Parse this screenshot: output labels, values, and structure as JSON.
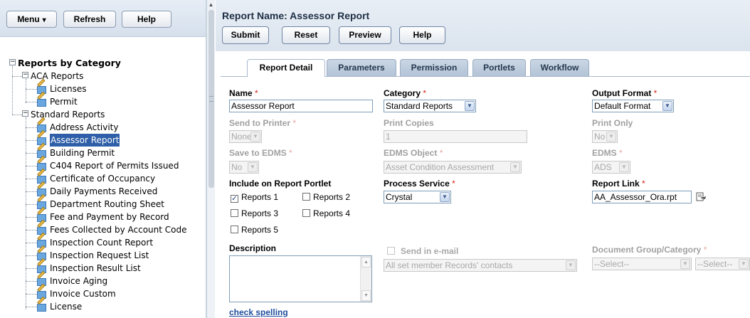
{
  "left_toolbar": {
    "menu_label": "Menu",
    "menu_caret": "▾",
    "refresh_label": "Refresh",
    "help_label": "Help"
  },
  "tree": {
    "root_label": "Reports by Category",
    "groups": [
      {
        "label": "ACA Reports",
        "items": [
          "Licenses",
          "Permit"
        ]
      },
      {
        "label": "Standard Reports",
        "items": [
          "Address Activity",
          "Assessor Report",
          "Building Permit",
          "C404 Report of Permits Issued",
          "Certificate of Occupancy",
          "Daily Payments Received",
          "Department Routing Sheet",
          "Fee and Payment by Record",
          "Fees Collected by Account Code",
          "Inspection Count Report",
          "Inspection Request List",
          "Inspection Result List",
          "Invoice Aging",
          "Invoice Custom",
          "License"
        ]
      }
    ],
    "selected_item": "Assessor Report"
  },
  "header": {
    "title": "Report Name: Assessor Report",
    "submit_label": "Submit",
    "reset_label": "Reset",
    "preview_label": "Preview",
    "help_label": "Help"
  },
  "tabs": [
    {
      "label": "Report Detail",
      "active": true
    },
    {
      "label": "Parameters",
      "active": false
    },
    {
      "label": "Permission",
      "active": false
    },
    {
      "label": "Portlets",
      "active": false
    },
    {
      "label": "Workflow",
      "active": false
    }
  ],
  "form": {
    "required_mark": "*",
    "name": {
      "label": "Name",
      "value": "Assessor Report"
    },
    "category": {
      "label": "Category",
      "value": "Standard Reports"
    },
    "output_format": {
      "label": "Output Format",
      "value": "Default Format"
    },
    "send_to_printer": {
      "label": "Send to Printer",
      "value": "None"
    },
    "print_copies": {
      "label": "Print Copies",
      "value": "1"
    },
    "print_only": {
      "label": "Print Only",
      "value": "No"
    },
    "save_to_edms": {
      "label": "Save to EDMS",
      "value": "No"
    },
    "edms_object": {
      "label": "EDMS Object",
      "value": "Asset Condition Assessment"
    },
    "edms": {
      "label": "EDMS",
      "value": "ADS"
    },
    "include_portlet": {
      "label": "Include on Report Portlet",
      "options": [
        {
          "label": "Reports 1",
          "checked": true
        },
        {
          "label": "Reports 2",
          "checked": false
        },
        {
          "label": "Reports 3",
          "checked": false
        },
        {
          "label": "Reports 4",
          "checked": false
        },
        {
          "label": "Reports 5",
          "checked": false
        }
      ]
    },
    "process_service": {
      "label": "Process Service",
      "value": "Crystal"
    },
    "report_link": {
      "label": "Report Link",
      "value": "AA_Assessor_Ora.rpt"
    },
    "description": {
      "label": "Description",
      "value": ""
    },
    "send_in_email": {
      "label": "Send in e-mail",
      "checked": false
    },
    "email_contacts": {
      "value": "All set member Records' contacts"
    },
    "document_group": {
      "label": "Document Group/Category",
      "group_value": "--Select--",
      "category_value": "--Select--"
    },
    "check_spelling_label": "check spelling"
  },
  "colors": {
    "accent": "#2f5fa8",
    "required": "#d0261b",
    "link": "#1f4e9c",
    "tab_inactive": "#b3c4d7"
  },
  "icons": {
    "tree_expander_collapse": "minus-box-icon",
    "tree_leaf": "report-edit-icon",
    "report_link_browse": "browse-file-icon"
  }
}
